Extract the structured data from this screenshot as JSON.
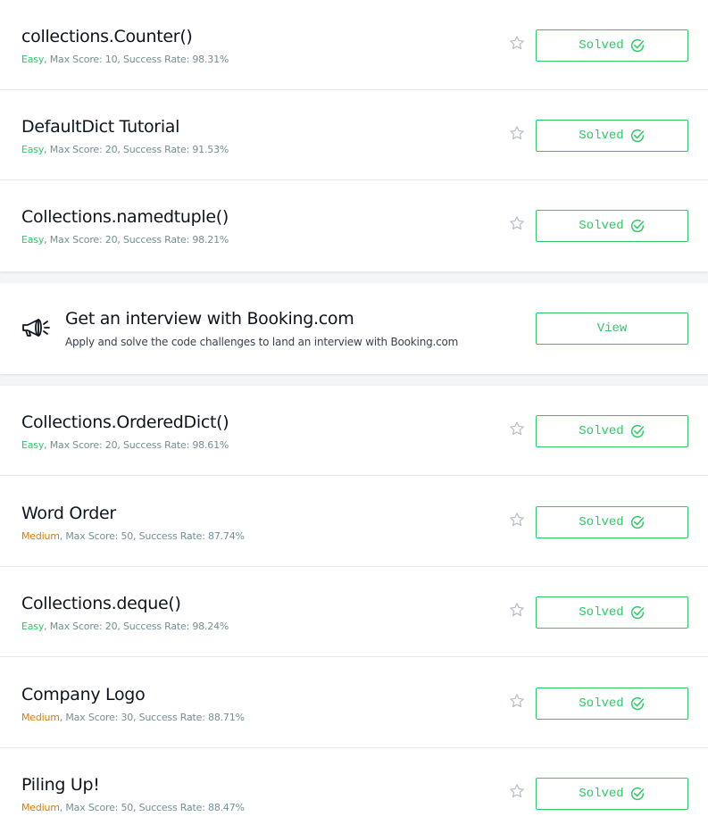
{
  "colors": {
    "accent": "#2ec866",
    "easy": "#2ec866",
    "medium": "#e07b00",
    "meta": "#738f93",
    "title": "#0e141e"
  },
  "icons": {
    "star": "star-icon",
    "check": "check-circle-icon",
    "megaphone": "megaphone-icon"
  },
  "challenges": [
    {
      "title": "collections.Counter()",
      "difficulty": "Easy",
      "stats": ", Max Score: 10, Success Rate: 98.31%",
      "status": "Solved"
    },
    {
      "title": "DefaultDict Tutorial",
      "difficulty": "Easy",
      "stats": ", Max Score: 20, Success Rate: 91.53%",
      "status": "Solved"
    },
    {
      "title": "Collections.namedtuple()",
      "difficulty": "Easy",
      "stats": ", Max Score: 20, Success Rate: 98.21%",
      "status": "Solved"
    },
    {
      "title": "Collections.OrderedDict()",
      "difficulty": "Easy",
      "stats": ", Max Score: 20, Success Rate: 98.61%",
      "status": "Solved"
    },
    {
      "title": "Word Order",
      "difficulty": "Medium",
      "stats": ", Max Score: 50, Success Rate: 87.74%",
      "status": "Solved"
    },
    {
      "title": "Collections.deque()",
      "difficulty": "Easy",
      "stats": ", Max Score: 20, Success Rate: 98.24%",
      "status": "Solved"
    },
    {
      "title": "Company Logo",
      "difficulty": "Medium",
      "stats": ", Max Score: 30, Success Rate: 88.71%",
      "status": "Solved"
    },
    {
      "title": "Piling Up!",
      "difficulty": "Medium",
      "stats": ", Max Score: 50, Success Rate: 88.47%",
      "status": "Solved"
    }
  ],
  "promo": {
    "title": "Get an interview with Booking.com",
    "subtitle": "Apply and solve the code challenges to land an interview with Booking.com",
    "button_label": "View"
  }
}
